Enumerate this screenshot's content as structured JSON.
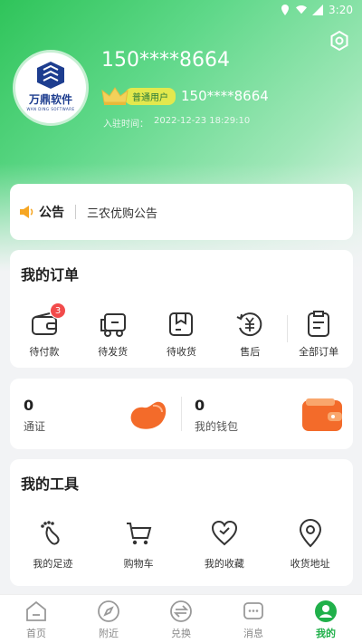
{
  "statusbar": {
    "time": "3:20"
  },
  "profile": {
    "logo_text": "万鼎软件",
    "logo_sub": "WAN DING SOFTWARE",
    "username": "150****8664",
    "level": "普通用户",
    "phone": "150****8664",
    "join_label": "入驻时间：",
    "join_time": "2022-12-23 18:29:10"
  },
  "notice": {
    "title": "公告",
    "text": "三农优购公告"
  },
  "orders": {
    "title": "我的订单",
    "items": [
      {
        "label": "待付款",
        "icon": "wallet-icon",
        "badge": "3"
      },
      {
        "label": "待发货",
        "icon": "truck-icon"
      },
      {
        "label": "待收货",
        "icon": "box-icon"
      },
      {
        "label": "售后",
        "icon": "yuan-refresh-icon"
      },
      {
        "label": "全部订单",
        "icon": "document-icon"
      }
    ]
  },
  "wallet": {
    "left": {
      "value": "0",
      "label": "通证"
    },
    "right": {
      "value": "0",
      "label": "我的钱包"
    }
  },
  "tools": {
    "title": "我的工具",
    "items": [
      {
        "label": "我的足迹",
        "icon": "footprint-icon"
      },
      {
        "label": "购物车",
        "icon": "cart-icon"
      },
      {
        "label": "我的收藏",
        "icon": "heart-icon"
      },
      {
        "label": "收货地址",
        "icon": "location-icon"
      }
    ]
  },
  "tabbar": {
    "items": [
      {
        "label": "首页",
        "icon": "home-icon"
      },
      {
        "label": "附近",
        "icon": "compass-icon"
      },
      {
        "label": "兑换",
        "icon": "exchange-icon"
      },
      {
        "label": "消息",
        "icon": "message-icon"
      },
      {
        "label": "我的",
        "icon": "profile-icon",
        "active": true
      }
    ]
  },
  "colors": {
    "brand": "#20b04a",
    "badge": "#f24b4b",
    "orange": "#f36b2a"
  }
}
